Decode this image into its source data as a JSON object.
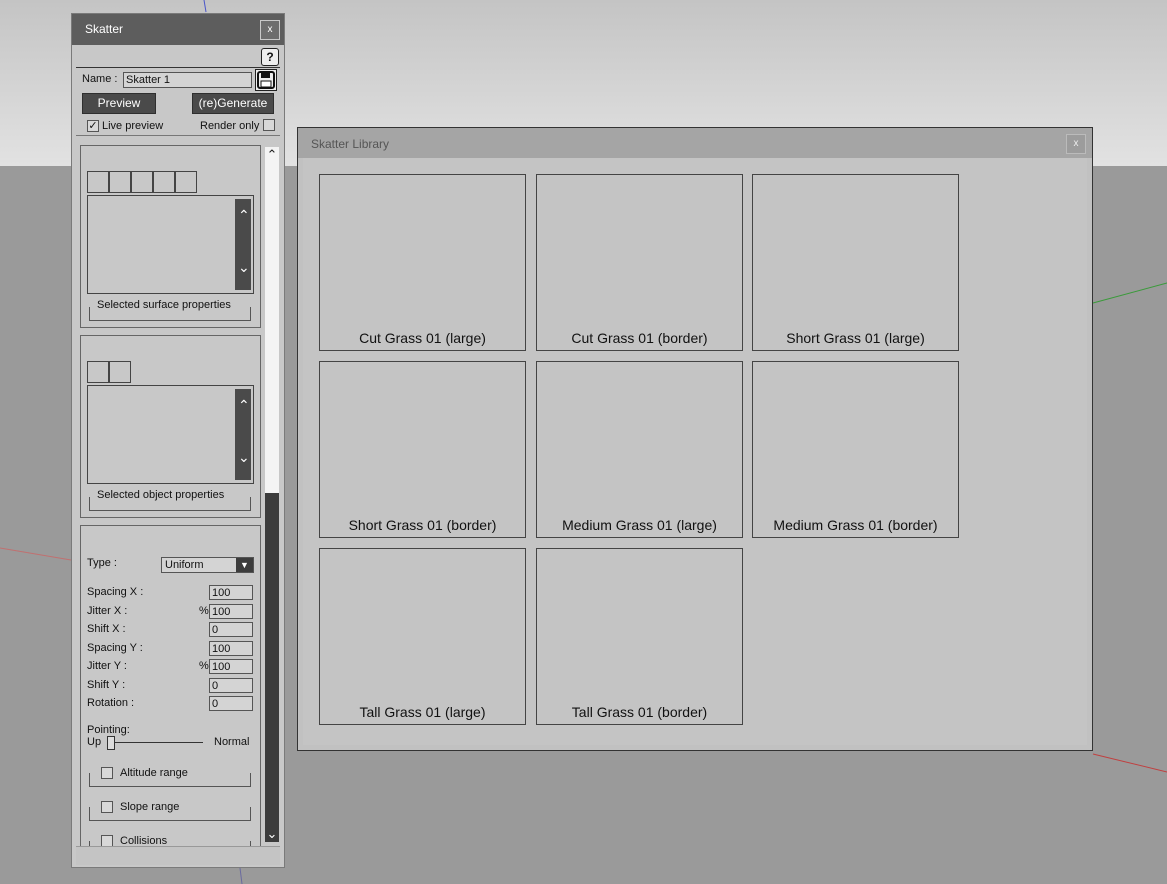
{
  "skatter": {
    "title": "Skatter",
    "close": "x",
    "help": "?",
    "name_label": "Name :",
    "name_value": "Skatter 1",
    "preview_btn": "Preview",
    "generate_btn": "(re)Generate",
    "live_preview": "Live preview",
    "live_preview_checked": true,
    "render_only": "Render only",
    "render_only_checked": false,
    "surfaces": {
      "group_label": "Selected surface properties"
    },
    "objects": {
      "group_label": "Selected object properties"
    },
    "distribution": {
      "type_label": "Type :",
      "type_value": "Uniform",
      "fields": [
        {
          "label": "Spacing X :",
          "suffix": "",
          "value": "100"
        },
        {
          "label": "Jitter X :",
          "suffix": "%",
          "value": "100"
        },
        {
          "label": "Shift X :",
          "suffix": "",
          "value": "0"
        },
        {
          "label": "Spacing Y :",
          "suffix": "",
          "value": "100"
        },
        {
          "label": "Jitter Y :",
          "suffix": "%",
          "value": "100"
        },
        {
          "label": "Shift Y :",
          "suffix": "",
          "value": "0"
        },
        {
          "label": "Rotation :",
          "suffix": "",
          "value": "0"
        }
      ],
      "pointing_label": "Pointing:",
      "pointing_min": "Up",
      "pointing_max": "Normal",
      "pointing_value": 0
    },
    "altitude_range": "Altitude range",
    "slope_range": "Slope range",
    "collisions": "Collisions"
  },
  "library": {
    "title": "Skatter Library",
    "close": "x",
    "items": [
      "Cut Grass 01 (large)",
      "Cut Grass 01 (border)",
      "Short Grass 01 (large)",
      "Short Grass 01 (border)",
      "Medium Grass 01 (large)",
      "Medium Grass 01 (border)",
      "Tall Grass 01 (large)",
      "Tall Grass 01 (border)"
    ]
  }
}
